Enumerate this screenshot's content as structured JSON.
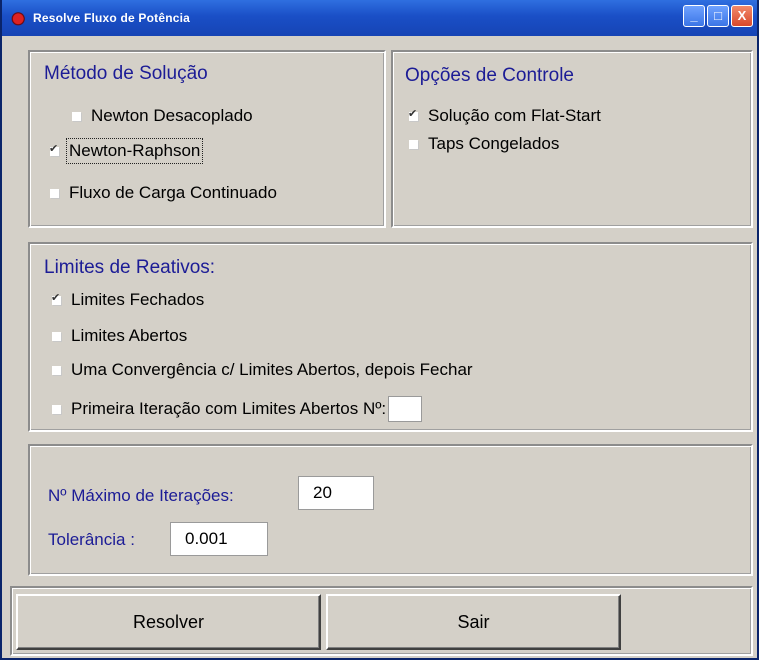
{
  "window": {
    "title": "Resolve Fluxo de Potência",
    "minimize": "_",
    "maximize": "□",
    "close": "X"
  },
  "metodo": {
    "title": "Método de Solução",
    "options": [
      {
        "label": "Newton Desacoplado",
        "checked": false
      },
      {
        "label": "Newton-Raphson",
        "checked": true
      },
      {
        "label": "Fluxo de Carga Continuado",
        "checked": false
      }
    ]
  },
  "controle": {
    "title": "Opções de Controle",
    "options": [
      {
        "label": "Solução com Flat-Start",
        "checked": true
      },
      {
        "label": "Taps Congelados",
        "checked": false
      }
    ]
  },
  "limites": {
    "title": "Limites de Reativos:",
    "options": [
      {
        "label": "Limites Fechados",
        "checked": true
      },
      {
        "label": "Limites Abertos",
        "checked": false
      },
      {
        "label": "Uma Convergência c/ Limites Abertos, depois Fechar",
        "checked": false
      },
      {
        "label": "Primeira Iteração com Limites Abertos Nº:",
        "checked": false,
        "field_value": ""
      }
    ]
  },
  "params": {
    "max_iter_label": "Nº Máximo de Iterações:",
    "max_iter_value": "20",
    "tol_label": "Tolerância :",
    "tol_value": "0.001"
  },
  "buttons": {
    "resolver": "Resolver",
    "sair": "Sair"
  }
}
